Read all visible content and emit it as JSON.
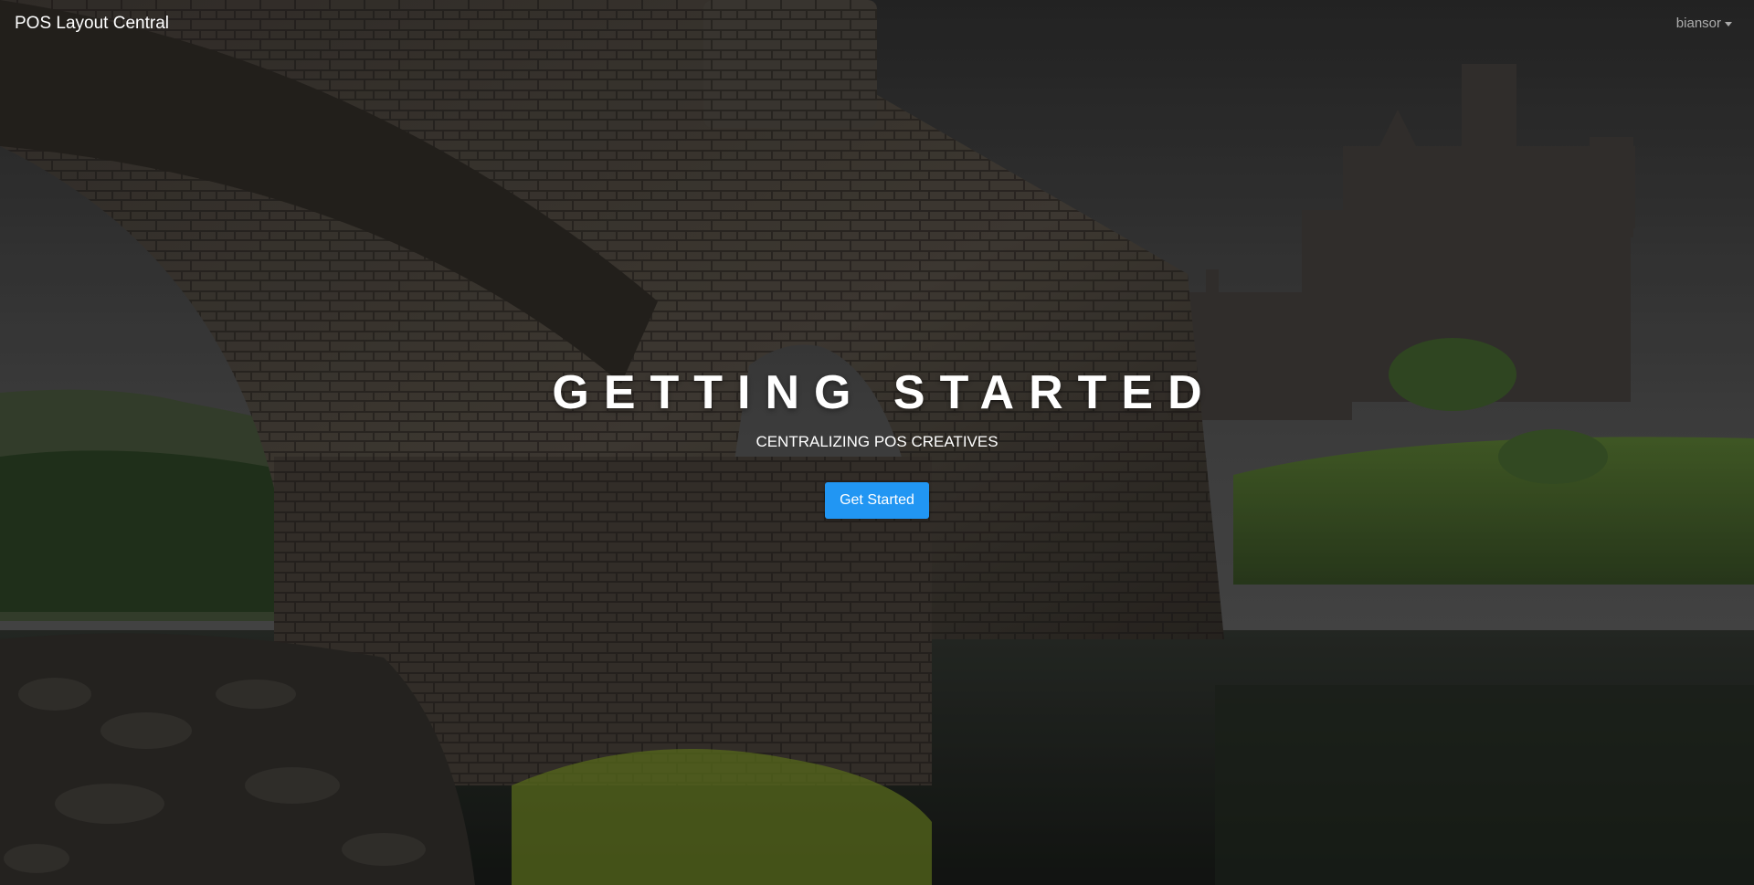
{
  "navbar": {
    "brand": "POS Layout Central",
    "user_name": "biansor"
  },
  "hero": {
    "title": "GETTING STARTED",
    "subtitle": "CENTRALIZING POS CREATIVES",
    "cta_label": "Get Started"
  },
  "colors": {
    "accent": "#2196f3",
    "text": "#ffffff",
    "muted_text": "#b4b4b4"
  }
}
